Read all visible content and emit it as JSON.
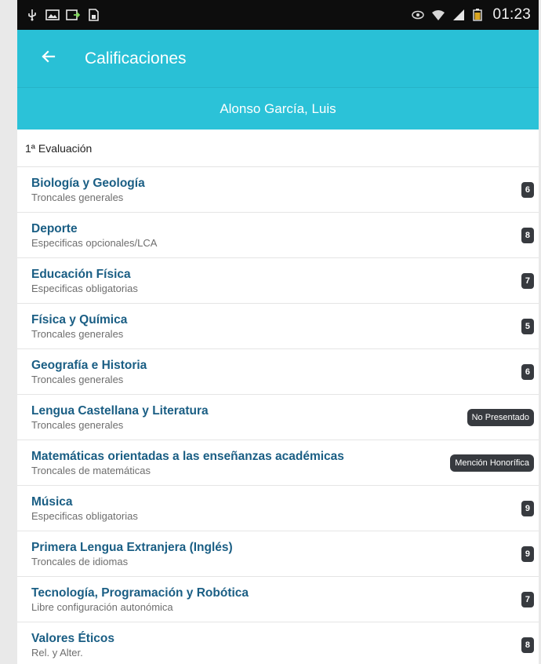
{
  "status_bar": {
    "left_icons": [
      "usb-icon",
      "image-icon",
      "cast-icon",
      "sim-icon"
    ],
    "right_icons": [
      "eye-icon",
      "wifi-icon",
      "signal-icon",
      "battery-icon"
    ],
    "time": "01:23"
  },
  "app_bar": {
    "back_icon": "arrow-left-icon",
    "title": "Calificaciones",
    "color": "#29c0d6"
  },
  "student": {
    "name": "Alonso García, Luis"
  },
  "evaluation": {
    "label": "1ª Evaluación"
  },
  "subjects": [
    {
      "name": "Biología y Geología",
      "category": "Troncales generales",
      "grade": "6"
    },
    {
      "name": "Deporte",
      "category": "Especificas opcionales/LCA",
      "grade": "8"
    },
    {
      "name": "Educación Física",
      "category": "Especificas obligatorias",
      "grade": "7"
    },
    {
      "name": "Física y Química",
      "category": "Troncales generales",
      "grade": "5"
    },
    {
      "name": "Geografía e Historia",
      "category": "Troncales generales",
      "grade": "6"
    },
    {
      "name": "Lengua Castellana y Literatura",
      "category": "Troncales generales",
      "grade": "No Presentado"
    },
    {
      "name": "Matemáticas orientadas a las enseñanzas académicas",
      "category": "Troncales de matemáticas",
      "grade": "Mención Honorífica"
    },
    {
      "name": "Música",
      "category": "Especificas obligatorias",
      "grade": "9"
    },
    {
      "name": "Primera Lengua Extranjera (Inglés)",
      "category": "Troncales de idiomas",
      "grade": "9"
    },
    {
      "name": "Tecnología, Programación y Robótica",
      "category": "Libre configuración autonómica",
      "grade": "7"
    },
    {
      "name": "Valores Éticos",
      "category": "Rel. y Alter.",
      "grade": "8"
    }
  ]
}
